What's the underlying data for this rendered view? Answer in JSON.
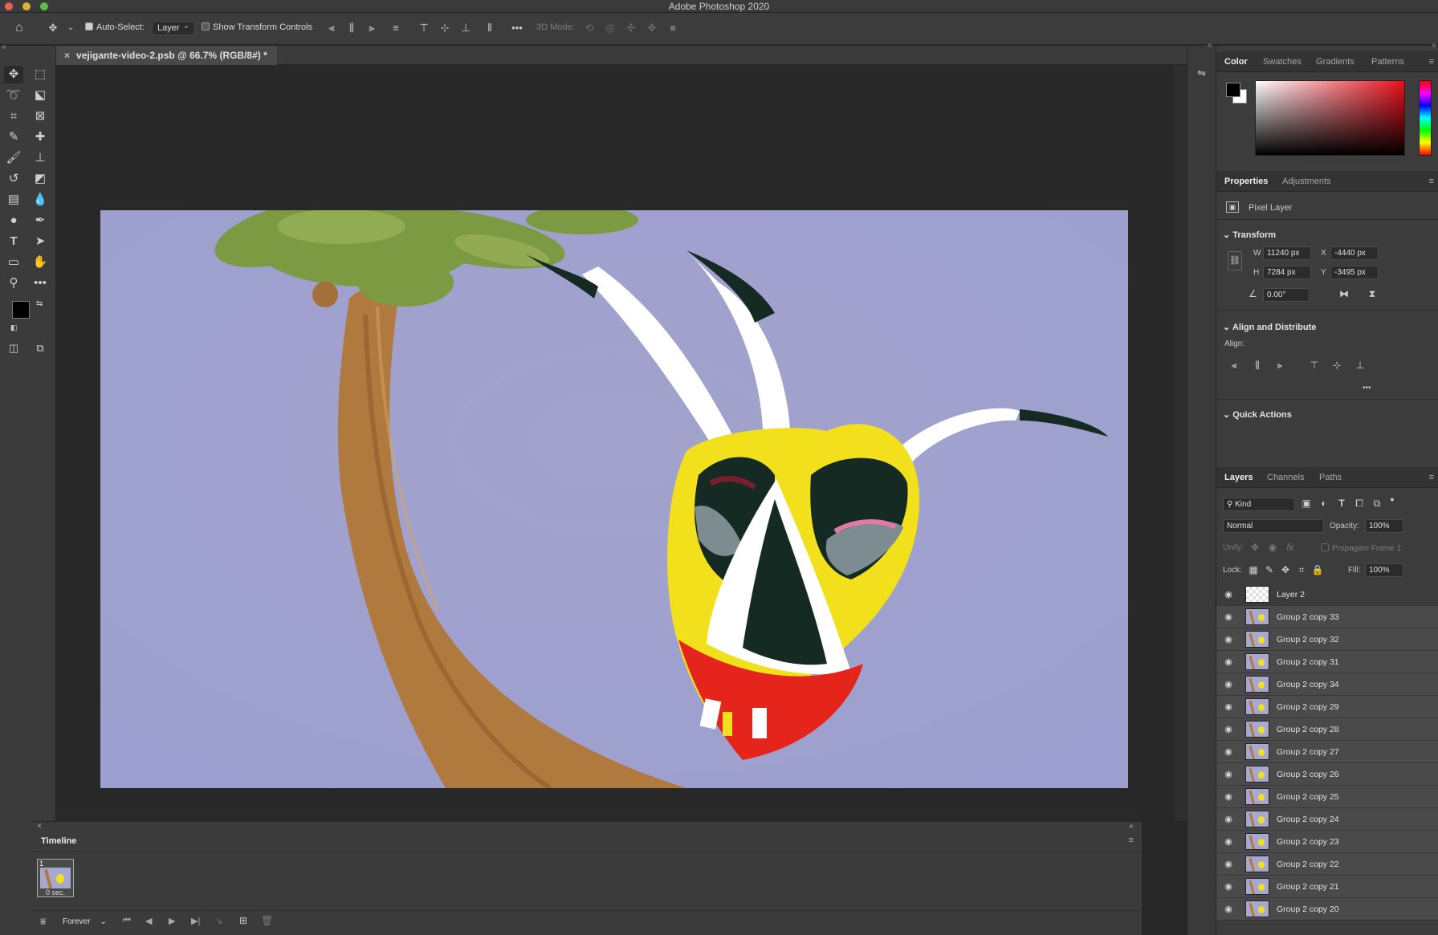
{
  "app": {
    "title": "Adobe Photoshop 2020"
  },
  "options_bar": {
    "auto_select_label": "Auto-Select:",
    "auto_select_checked": true,
    "auto_select_target": "Layer",
    "show_transform_label": "Show Transform Controls",
    "show_transform_checked": false,
    "mode_3d_label": "3D Mode:"
  },
  "document": {
    "tab_title": "vejigante-video-2.psb @ 66.7% (RGB/8#) *",
    "close_glyph": "×"
  },
  "color_panel": {
    "tabs": [
      "Color",
      "Swatches",
      "Gradients",
      "Patterns"
    ],
    "active_tab": "Color",
    "foreground": "#000000",
    "background": "#ffffff",
    "hue_color": "#e8101c"
  },
  "properties_panel": {
    "tabs": [
      "Properties",
      "Adjustments"
    ],
    "layer_type": "Pixel Layer",
    "transform_title": "Transform",
    "w_label": "W",
    "w_value": "11240 px",
    "h_label": "H",
    "h_value": "7284 px",
    "x_label": "X",
    "x_value": "-4440 px",
    "y_label": "Y",
    "y_value": "-3495 px",
    "angle_value": "0.00°",
    "align_title": "Align and Distribute",
    "align_label": "Align:",
    "more": "•••",
    "quick_actions_title": "Quick Actions"
  },
  "layers_panel": {
    "tabs": [
      "Layers",
      "Channels",
      "Paths"
    ],
    "filter_kind": "Kind",
    "blend_mode": "Normal",
    "opacity_label": "Opacity:",
    "opacity_value": "100%",
    "unify_label": "Unify:",
    "propagate_label": "Propagate Frame 1",
    "lock_label": "Lock:",
    "fill_label": "Fill:",
    "fill_value": "100%",
    "layers": [
      {
        "name": "Layer 2",
        "transparent": true
      },
      {
        "name": "Group 2 copy 33"
      },
      {
        "name": "Group 2 copy 32"
      },
      {
        "name": "Group 2 copy 31"
      },
      {
        "name": "Group 2 copy 34"
      },
      {
        "name": "Group 2 copy 29"
      },
      {
        "name": "Group 2 copy 28"
      },
      {
        "name": "Group 2 copy 27"
      },
      {
        "name": "Group 2 copy 26"
      },
      {
        "name": "Group 2 copy 25"
      },
      {
        "name": "Group 2 copy 24"
      },
      {
        "name": "Group 2 copy 23"
      },
      {
        "name": "Group 2 copy 22"
      },
      {
        "name": "Group 2 copy 21"
      },
      {
        "name": "Group 2 copy 20"
      }
    ]
  },
  "timeline": {
    "title": "Timeline",
    "frame_number": "1",
    "frame_delay": "0 sec.",
    "loop": "Forever"
  }
}
